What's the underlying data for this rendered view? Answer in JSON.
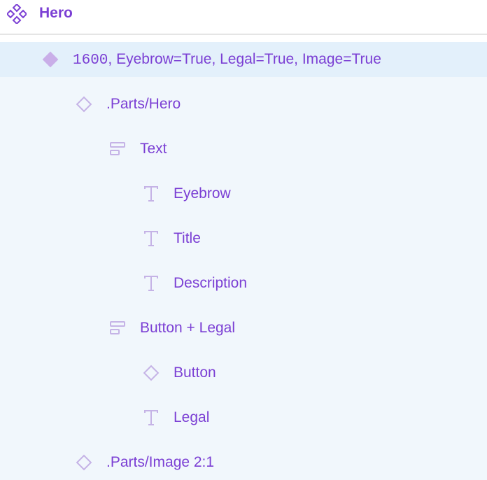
{
  "header": {
    "title": "Hero",
    "icon": "component-set-icon"
  },
  "layers": [
    {
      "name_prefix": "1600",
      "name": ", Eyebrow=True, Legal=True, Image=True",
      "icon": "component-filled-icon",
      "depth": 1,
      "selected": true
    },
    {
      "name": ".Parts/Hero",
      "icon": "instance-icon",
      "depth": 2
    },
    {
      "name": "Text",
      "icon": "auto-layout-vertical-icon",
      "depth": 3
    },
    {
      "name": "Eyebrow",
      "icon": "text-icon",
      "depth": 4
    },
    {
      "name": "Title",
      "icon": "text-icon",
      "depth": 4
    },
    {
      "name": "Description",
      "icon": "text-icon",
      "depth": 4
    },
    {
      "name": "Button + Legal",
      "icon": "auto-layout-vertical-icon",
      "depth": 3
    },
    {
      "name": "Button",
      "icon": "instance-icon",
      "depth": 4
    },
    {
      "name": "Legal",
      "icon": "text-icon",
      "depth": 4
    },
    {
      "name": ".Parts/Image 2:1",
      "icon": "instance-icon",
      "depth": 2
    }
  ],
  "colors": {
    "accent": "#7b3fd4",
    "selected_bg": "#e3f0fb",
    "tree_bg": "#f1f7fc",
    "icon_muted": "#c5b3e6"
  }
}
